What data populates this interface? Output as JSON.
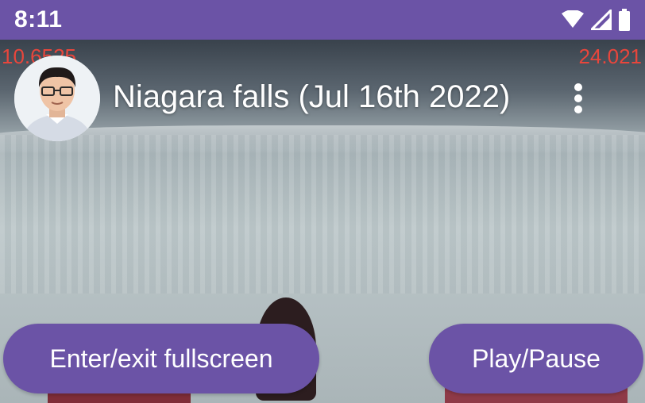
{
  "status_bar": {
    "time": "8:11",
    "icons": [
      "wifi-icon",
      "signal-icon",
      "battery-icon"
    ],
    "background": "#6b53a6"
  },
  "overlay": {
    "debug_left": "10.6525",
    "debug_right": "24.021",
    "debug_color": "#e8463c"
  },
  "video": {
    "title": "Niagara falls (Jul 16th 2022)",
    "menu_icon": "more-vertical-icon",
    "avatar": "user-avatar"
  },
  "controls": {
    "fullscreen_label": "Enter/exit fullscreen",
    "play_pause_label": "Play/Pause",
    "accent": "#6b53a6"
  }
}
